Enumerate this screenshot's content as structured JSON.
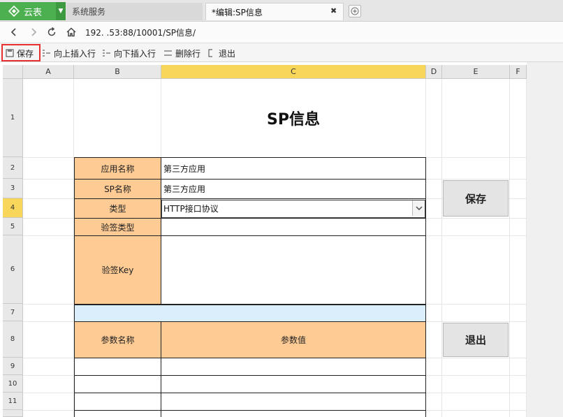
{
  "tabs": {
    "app": "云表",
    "system": "系统服务",
    "editor": "*编辑:SP信息"
  },
  "address": {
    "url": "192.          .53:88/10001/SP信息/"
  },
  "toolbar": {
    "save": "保存",
    "insert_above": "向上插入行",
    "insert_below": "向下插入行",
    "delete_row": "删除行",
    "exit": "退出"
  },
  "sheet": {
    "columns": [
      "A",
      "B",
      "C",
      "D",
      "E",
      "F"
    ],
    "rows": [
      "1",
      "2",
      "3",
      "4",
      "5",
      "6",
      "7",
      "8",
      "9",
      "10",
      "11"
    ],
    "active_cell": "C4",
    "title": "SP信息",
    "fields": {
      "app_name_label": "应用名称",
      "app_name_value": "第三方应用",
      "sp_name_label": "SP名称",
      "sp_name_value": "第三方应用",
      "type_label": "类型",
      "type_value": "HTTP接口协议",
      "sign_type_label": "验签类型",
      "sign_type_value": "",
      "sign_key_label": "验签Key",
      "sign_key_value": ""
    },
    "params_table": {
      "headers": [
        "参数名称",
        "参数值"
      ]
    },
    "buttons": {
      "save": "保存",
      "exit": "退出"
    }
  }
}
